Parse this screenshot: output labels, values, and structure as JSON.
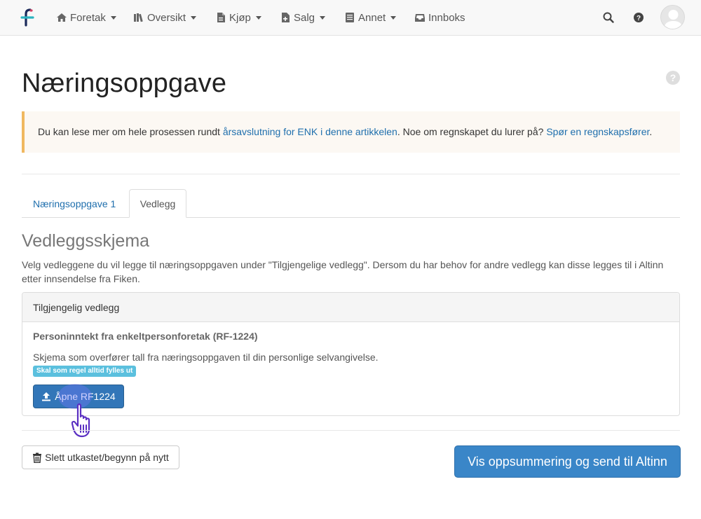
{
  "nav": {
    "logo": "fiken-logo",
    "items": [
      {
        "label": "Foretak",
        "icon": "home-icon",
        "dropdown": true
      },
      {
        "label": "Oversikt",
        "icon": "books-icon",
        "dropdown": true
      },
      {
        "label": "Kjøp",
        "icon": "document-icon",
        "dropdown": true
      },
      {
        "label": "Salg",
        "icon": "document-plus-icon",
        "dropdown": true
      },
      {
        "label": "Annet",
        "icon": "ledger-icon",
        "dropdown": true
      },
      {
        "label": "Innboks",
        "icon": "inbox-icon",
        "dropdown": false
      }
    ],
    "right_icons": [
      "search-icon",
      "help-icon",
      "avatar"
    ]
  },
  "page": {
    "title": "Næringsoppgave",
    "help": "?"
  },
  "alert": {
    "text_before": "Du kan lese mer om hele prosessen rundt ",
    "link1": "årsavslutning for ENK i denne artikkelen",
    "text_middle": ". Noe om regnskapet du lurer på? ",
    "link2": "Spør en regnskapsfører",
    "text_after": "."
  },
  "tabs": [
    {
      "label": "Næringsoppgave 1",
      "active": false
    },
    {
      "label": "Vedlegg",
      "active": true
    }
  ],
  "section": {
    "title": "Vedleggsskjema",
    "description": "Velg vedleggene du vil legge til næringsoppgaven under \"Tilgjengelige vedlegg\". Dersom du har behov for andre vedlegg kan disse legges til i Altinn etter innsendelse fra Fiken."
  },
  "panel": {
    "heading": "Tilgjengelig vedlegg",
    "form_title": "Personinntekt fra enkeltpersonforetak (RF-1224)",
    "form_desc": "Skjema som overfører tall fra næringsoppgaven til din personlige selvangivelse.",
    "badge": "Skal som regel alltid fylles ut",
    "open_button": "Åpne RF1224"
  },
  "footer": {
    "delete_button": "Slett utkastet/begynn på nytt",
    "submit_button": "Vis oppsummering og send til Altinn"
  },
  "colors": {
    "primary": "#3276b8",
    "link": "#1f6fad",
    "alert_border": "#f0b860",
    "alert_bg": "#fcf8f3",
    "badge": "#5bc0de"
  }
}
